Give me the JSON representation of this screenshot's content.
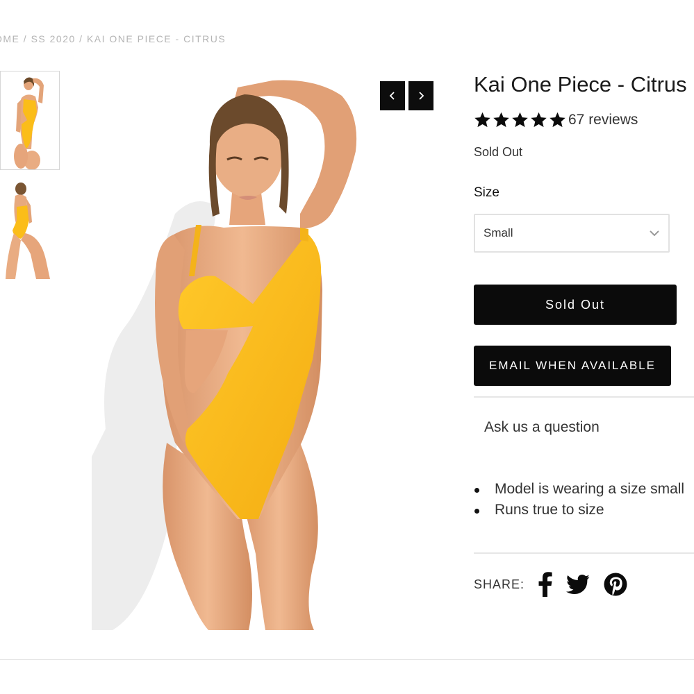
{
  "breadcrumb": {
    "items": [
      "OME",
      "SS 2020",
      "KAI ONE PIECE - CITRUS"
    ],
    "separator": " / "
  },
  "gallery": {
    "thumbnails": [
      "front-view",
      "back-view"
    ],
    "main_image": "model-front-yellow-one-piece",
    "prev_icon": "chevron-left-icon",
    "next_icon": "chevron-right-icon"
  },
  "product": {
    "title": "Kai One Piece - Citrus",
    "rating": 5,
    "rating_max": 5,
    "reviews_text": "67 reviews",
    "stock_status": "Sold Out"
  },
  "size": {
    "label": "Size",
    "selected": "Small"
  },
  "buttons": {
    "sold_out": "Sold Out",
    "email": "EMAIL WHEN AVAILABLE"
  },
  "ask": "Ask us a question",
  "details": [
    "Model is wearing a size small",
    "Runs true to size"
  ],
  "share": {
    "label": "SHARE:",
    "icons": [
      "facebook-icon",
      "twitter-icon",
      "pinterest-icon"
    ]
  },
  "colors": {
    "swimsuit": "#fbbd19",
    "skin": "#e7a97e",
    "button": "#0b0b0b",
    "breadcrumb": "#b5b5b5"
  }
}
